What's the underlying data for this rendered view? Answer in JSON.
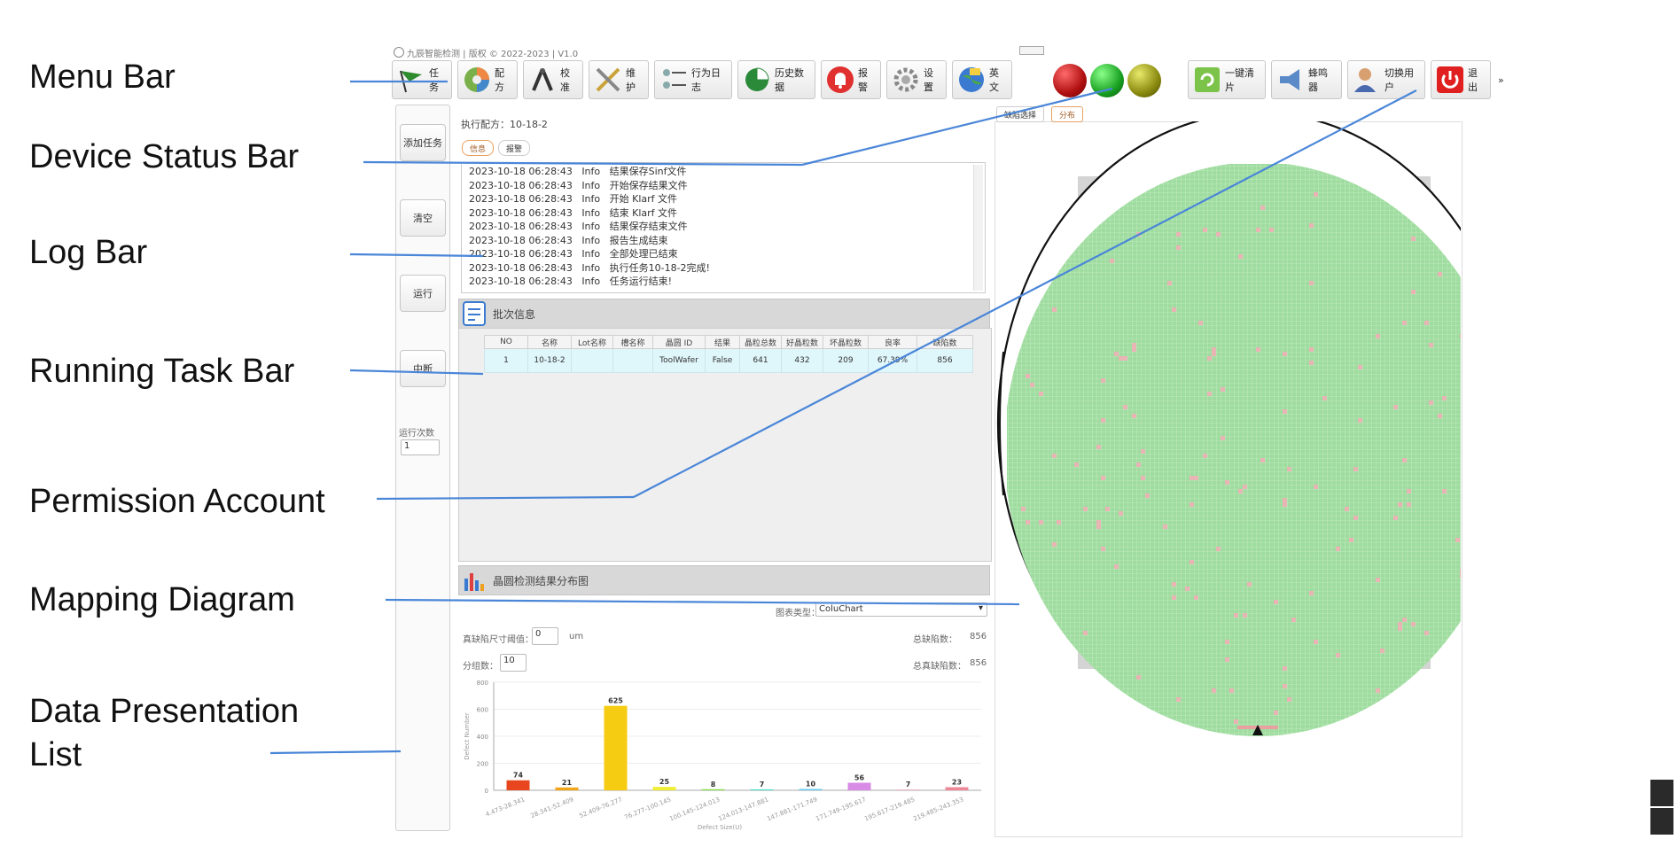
{
  "annotations": [
    {
      "key": "menu",
      "text": "Menu Bar"
    },
    {
      "key": "device",
      "text": "Device Status Bar"
    },
    {
      "key": "log",
      "text": "Log Bar"
    },
    {
      "key": "task",
      "text": "Running Task Bar"
    },
    {
      "key": "perm",
      "text": "Permission Account"
    },
    {
      "key": "map",
      "text": "Mapping Diagram"
    },
    {
      "key": "data1",
      "text": "Data Presentation"
    },
    {
      "key": "data2",
      "text": "List"
    }
  ],
  "app": {
    "title": "九辰智能检测 | 版权 © 2022-2023 | V1.0"
  },
  "toolbar": {
    "task": "任务",
    "recipe": "配方",
    "calibrate": "校准",
    "maintain": "维护",
    "behavior_log": "行为日志",
    "history": "历史数据",
    "alarm": "报警",
    "settings": "设置",
    "english": "英文",
    "clear_wafer": "一键清片",
    "buzzer": "蜂鸣器",
    "switch_user": "切换用户",
    "exit": "退出",
    "more": "»"
  },
  "status_lights": {
    "red": "#b01010",
    "green": "#18a020",
    "olive": "#8a8a10"
  },
  "sidebar": {
    "add_task": "添加任务",
    "clear": "清空",
    "run": "运行",
    "stop": "中断",
    "run_count_label": "运行次数",
    "run_count_value": "1"
  },
  "recipe": {
    "label": "执行配方：",
    "value": "10-18-2"
  },
  "info_tabs": {
    "info": "信息",
    "alarm": "报警"
  },
  "log": {
    "lines": [
      "2023-10-18 06:28:43   Info   结果保存Sinf文件",
      "2023-10-18 06:28:43   Info   开始保存结果文件",
      "2023-10-18 06:28:43   Info   开始 Klarf 文件",
      "2023-10-18 06:28:43   Info   结束 Klarf 文件",
      "2023-10-18 06:28:43   Info   结果保存结束文件",
      "2023-10-18 06:28:43   Info   报告生成结束",
      "2023-10-18 06:28:43   Info   全部处理已结束",
      "2023-10-18 06:28:43   Info   执行任务10-18-2完成!",
      "2023-10-18 06:28:43   Info   任务运行结束!"
    ]
  },
  "batch": {
    "title": "批次信息",
    "headers": [
      "NO",
      "名称",
      "Lot名称",
      "槽名称",
      "晶圆 ID",
      "结果",
      "晶粒总数",
      "好晶粒数",
      "坏晶粒数",
      "良率",
      "缺陷数"
    ],
    "row": [
      "1",
      "10-18-2",
      "",
      "",
      "ToolWafer",
      "False",
      "641",
      "432",
      "209",
      "67.39%",
      "856"
    ]
  },
  "dist": {
    "title": "晶圆检测结果分布图",
    "chart_type_label": "图表类型：",
    "chart_type_value": "ColuChart",
    "size_threshold_label": "真缺陷尺寸阈值：",
    "size_threshold_value": "0",
    "size_unit": "um",
    "groups_label": "分组数：",
    "groups_value": "10",
    "total_defects_label": "总缺陷数：",
    "total_defects_value": "856",
    "true_defects_label": "总真缺陷数：",
    "true_defects_value": "856"
  },
  "chart_data": {
    "type": "bar",
    "categories": [
      "4.473-28.341",
      "28.341-52.409",
      "52.409-76.277",
      "76.277-100.145",
      "100.145-124.013",
      "124.013-147.881",
      "147.881-171.749",
      "171.749-195.617",
      "195.617-219.485",
      "219.485-243.353"
    ],
    "values": [
      74,
      21,
      625,
      25,
      8,
      7,
      10,
      56,
      7,
      23
    ],
    "colors": [
      "#e8461e",
      "#f2a418",
      "#f6cc12",
      "#f0ee30",
      "#88dd44",
      "#44ddc8",
      "#66ccee",
      "#d88ce6",
      "#eebbcc",
      "#ee8899"
    ],
    "ylabel": "Defect Number",
    "xlabel": "Defect Size(U)",
    "ylim": [
      0,
      800
    ],
    "yticks": [
      0,
      200,
      400,
      600,
      800
    ],
    "grid": true
  },
  "right_tabs": {
    "defect_select": "缺陷选择",
    "distribution": "分布"
  },
  "wafer": {
    "die_color": "#9fdc9f",
    "defect_color": "#e8b4b4"
  },
  "colors": {
    "accent": "#4a86d8",
    "leader": "#4a86d8"
  }
}
